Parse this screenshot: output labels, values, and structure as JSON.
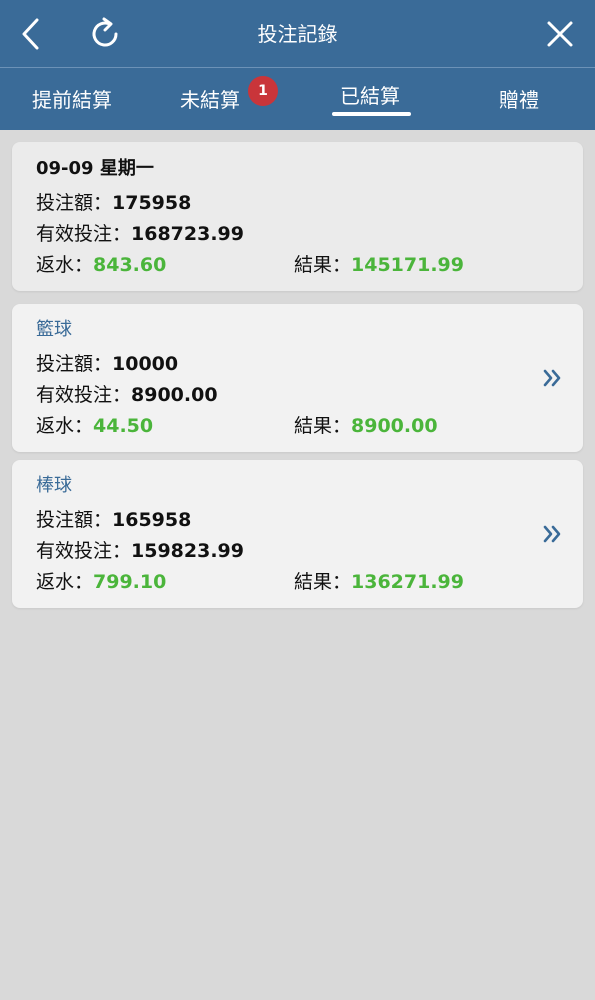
{
  "header": {
    "title": "投注記錄"
  },
  "tabs": [
    {
      "label": "提前結算"
    },
    {
      "label": "未結算",
      "badge": "1"
    },
    {
      "label": "已結算",
      "active": true
    },
    {
      "label": "贈禮"
    }
  ],
  "colors": {
    "header_bg": "#3a6b98",
    "positive_green": "#4bb53b",
    "badge_red": "#c9353a",
    "sport_label": "#3a6b98"
  },
  "summary": {
    "date": "09-09 星期一",
    "bet_amount_label": "投注額：",
    "bet_amount": "175958",
    "valid_bet_label": "有效投注：",
    "valid_bet": "168723.99",
    "rebate_label": "返水：",
    "rebate": "843.60",
    "result_label": "結果：",
    "result": "145171.99"
  },
  "sports": [
    {
      "name": "籃球",
      "bet_amount_label": "投注額：",
      "bet_amount": "10000",
      "valid_bet_label": "有效投注：",
      "valid_bet": "8900.00",
      "rebate_label": "返水：",
      "rebate": "44.50",
      "result_label": "結果：",
      "result": "8900.00",
      "icon": "double-chevron-right-icon"
    },
    {
      "name": "棒球",
      "bet_amount_label": "投注額：",
      "bet_amount": "165958",
      "valid_bet_label": "有效投注：",
      "valid_bet": "159823.99",
      "rebate_label": "返水：",
      "rebate": "799.10",
      "result_label": "結果：",
      "result": "136271.99",
      "icon": "double-chevron-right-icon"
    }
  ]
}
